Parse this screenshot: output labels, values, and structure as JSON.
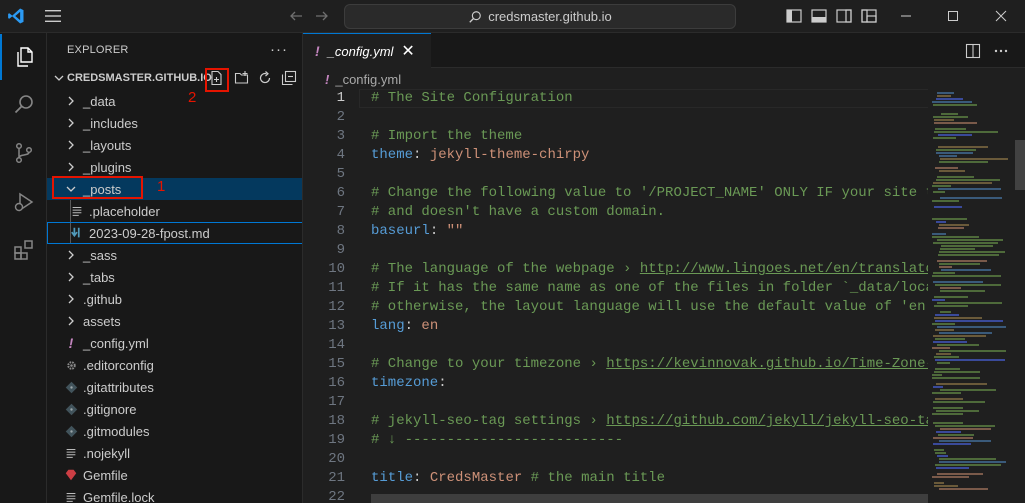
{
  "titlebar": {
    "search_text": "credsmaster.github.io"
  },
  "activitybar": {
    "items": [
      "explorer-icon",
      "search-icon",
      "source-control-icon",
      "run-debug-icon",
      "extensions-icon"
    ]
  },
  "explorer": {
    "title": "EXPLORER",
    "more": "···",
    "project": "CREDSMASTER.GITHUB.IO",
    "annotations": [
      "1",
      "2"
    ],
    "tree": [
      {
        "label": "_data",
        "type": "folder",
        "expanded": false
      },
      {
        "label": "_includes",
        "type": "folder",
        "expanded": false
      },
      {
        "label": "_layouts",
        "type": "folder",
        "expanded": false
      },
      {
        "label": "_plugins",
        "type": "folder",
        "expanded": false
      },
      {
        "label": "_posts",
        "type": "folder",
        "expanded": true
      },
      {
        "label": ".placeholder",
        "type": "file",
        "icon": "lines-file-icon"
      },
      {
        "label": "2023-09-28-fpost.md",
        "type": "file",
        "icon": "markdown-file-icon"
      },
      {
        "label": "_sass",
        "type": "folder",
        "expanded": false
      },
      {
        "label": "_tabs",
        "type": "folder",
        "expanded": false
      },
      {
        "label": ".github",
        "type": "folder",
        "expanded": false
      },
      {
        "label": "assets",
        "type": "folder",
        "expanded": false
      },
      {
        "label": "_config.yml",
        "type": "file",
        "icon": "yaml-file-icon"
      },
      {
        "label": ".editorconfig",
        "type": "file",
        "icon": "gear-file-icon"
      },
      {
        "label": ".gitattributes",
        "type": "file",
        "icon": "git-file-icon"
      },
      {
        "label": ".gitignore",
        "type": "file",
        "icon": "git-file-icon"
      },
      {
        "label": ".gitmodules",
        "type": "file",
        "icon": "git-file-icon"
      },
      {
        "label": ".nojekyll",
        "type": "file",
        "icon": "lines-file-icon"
      },
      {
        "label": "Gemfile",
        "type": "file",
        "icon": "ruby-file-icon"
      },
      {
        "label": "Gemfile.lock",
        "type": "file",
        "icon": "lines-file-icon"
      }
    ]
  },
  "editor": {
    "tab_label": "_config.yml",
    "tab_bang": "!",
    "tab_close": "✕",
    "breadcrumb": "_config.yml",
    "lines": [
      {
        "n": "1",
        "parts": [
          [
            "c",
            "# The Site Configuration"
          ]
        ]
      },
      {
        "n": "2",
        "parts": []
      },
      {
        "n": "3",
        "parts": [
          [
            "c",
            "# Import the theme"
          ]
        ]
      },
      {
        "n": "4",
        "parts": [
          [
            "k",
            "theme"
          ],
          [
            "p",
            ": "
          ],
          [
            "v",
            "jekyll-theme-chirpy"
          ]
        ]
      },
      {
        "n": "5",
        "parts": []
      },
      {
        "n": "6",
        "parts": [
          [
            "c",
            "# Change the following value to '/PROJECT_NAME' ONLY IF your site type is"
          ]
        ]
      },
      {
        "n": "7",
        "parts": [
          [
            "c",
            "# and doesn't have a custom domain."
          ]
        ]
      },
      {
        "n": "8",
        "parts": [
          [
            "k",
            "baseurl"
          ],
          [
            "p",
            ": "
          ],
          [
            "v",
            "\"\""
          ]
        ]
      },
      {
        "n": "9",
        "parts": []
      },
      {
        "n": "10",
        "parts": [
          [
            "c",
            "# The language of the webpage › "
          ],
          [
            "l",
            "http://www.lingoes.net/en/translator/langcode.htm"
          ]
        ]
      },
      {
        "n": "11",
        "parts": [
          [
            "c",
            "# If it has the same name as one of the files in folder `_data/locales`,"
          ]
        ]
      },
      {
        "n": "12",
        "parts": [
          [
            "c",
            "# otherwise, the layout language will use the default value of 'en'."
          ]
        ]
      },
      {
        "n": "13",
        "parts": [
          [
            "k",
            "lang"
          ],
          [
            "p",
            ": "
          ],
          [
            "v",
            "en"
          ]
        ]
      },
      {
        "n": "14",
        "parts": []
      },
      {
        "n": "15",
        "parts": [
          [
            "c",
            "# Change to your timezone › "
          ],
          [
            "l",
            "https://kevinnovak.github.io/Time-Zone-Picker"
          ]
        ]
      },
      {
        "n": "16",
        "parts": [
          [
            "k",
            "timezone"
          ],
          [
            "p",
            ":"
          ]
        ]
      },
      {
        "n": "17",
        "parts": []
      },
      {
        "n": "18",
        "parts": [
          [
            "c",
            "# jekyll-seo-tag settings › "
          ],
          [
            "l",
            "https://github.com/jekyll/jekyll-seo-tag/blob"
          ]
        ]
      },
      {
        "n": "19",
        "parts": [
          [
            "c",
            "# ↓ --------------------------"
          ]
        ]
      },
      {
        "n": "20",
        "parts": []
      },
      {
        "n": "21",
        "parts": [
          [
            "k",
            "title"
          ],
          [
            "p",
            ": "
          ],
          [
            "v",
            "CredsMaster "
          ],
          [
            "c",
            "# the main title"
          ]
        ]
      },
      {
        "n": "22",
        "parts": []
      }
    ]
  },
  "colors": {
    "accent": "#0078d4",
    "annotation": "#e51400",
    "selected_row": "#04395e"
  }
}
